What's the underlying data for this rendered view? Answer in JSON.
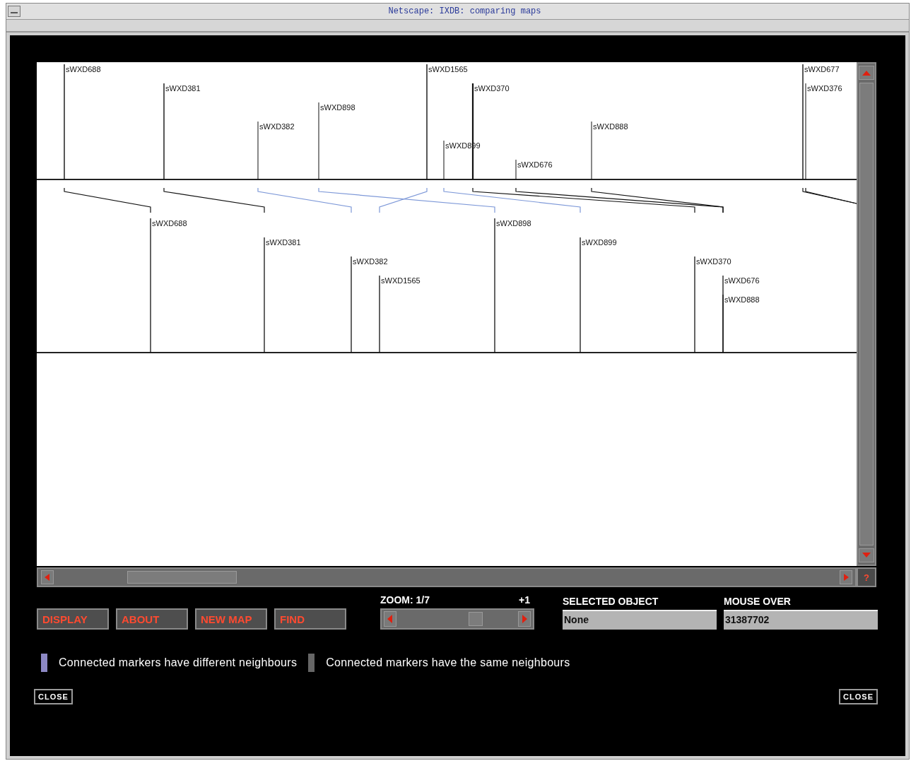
{
  "window": {
    "title": "Netscape: IXDB: comparing maps"
  },
  "map": {
    "top_markers": [
      "sWXD688",
      "sWXD381",
      "sWXD382",
      "sWXD898",
      "sWXD1565",
      "sWXD899",
      "sWXD370",
      "sWXD676",
      "sWXD888",
      "sWXD677",
      "sWXD376"
    ],
    "bottom_markers": [
      "sWXD688",
      "sWXD381",
      "sWXD382",
      "sWXD1565",
      "sWXD898",
      "sWXD899",
      "sWXD370",
      "sWXD676",
      "sWXD888"
    ],
    "links": [
      {
        "kind": "same"
      },
      {
        "kind": "same"
      },
      {
        "kind": "different"
      },
      {
        "kind": "different"
      },
      {
        "kind": "different"
      },
      {
        "kind": "different"
      },
      {
        "kind": "same"
      },
      {
        "kind": "same"
      },
      {
        "kind": "same"
      },
      {
        "kind": "same"
      },
      {
        "kind": "same"
      }
    ]
  },
  "scroll_help": "?",
  "buttons": [
    "DISPLAY",
    "ABOUT",
    "NEW MAP",
    "FIND"
  ],
  "zoom": {
    "label": "ZOOM: 1/7",
    "step": "+1",
    "level": 0.65
  },
  "selected_object": {
    "label": "SELECTED OBJECT",
    "value": "None"
  },
  "mouse_over": {
    "label": "MOUSE OVER",
    "value": "31387702"
  },
  "legend": [
    {
      "color": "#8c88c4",
      "text": "Connected markers have different neighbours"
    },
    {
      "color": "#666666",
      "text": "Connected markers have the same neighbours"
    }
  ],
  "close_buttons": [
    "CLOSE",
    "CLOSE"
  ]
}
